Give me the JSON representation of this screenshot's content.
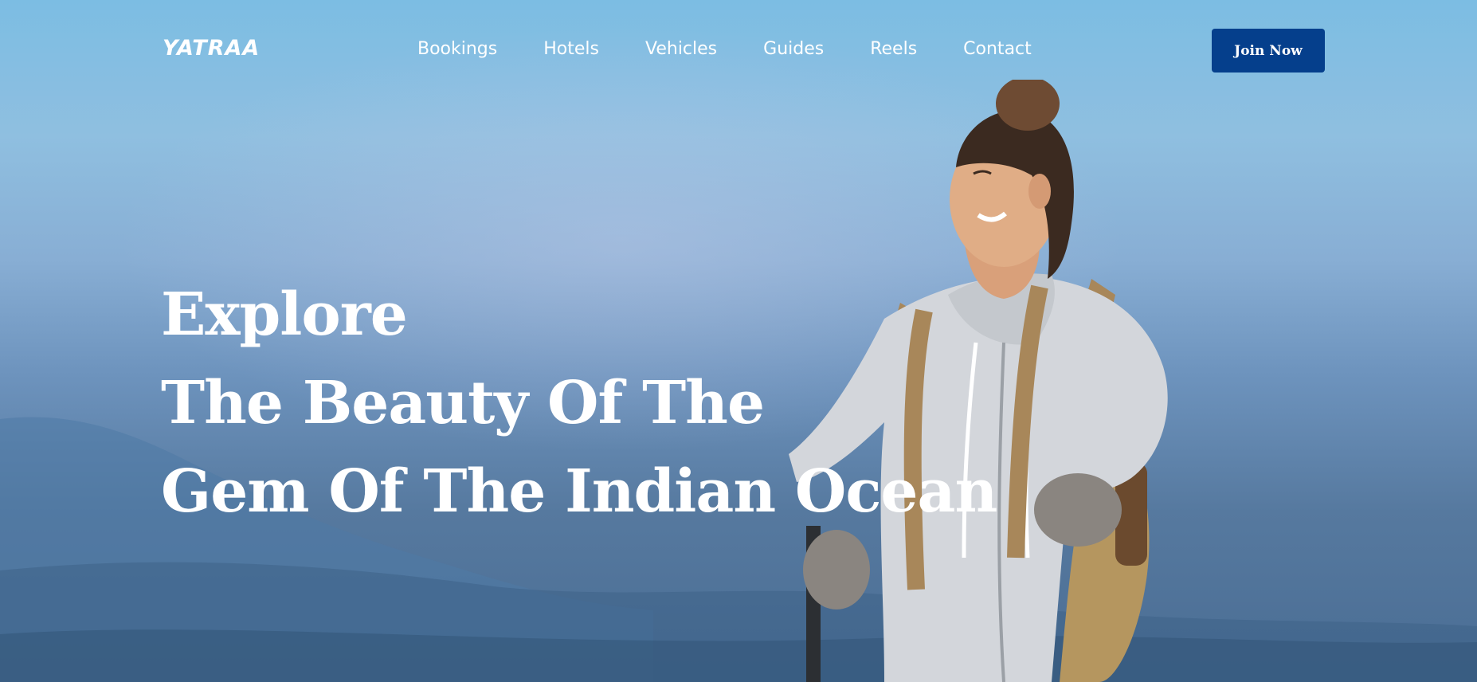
{
  "brand": {
    "logo": "YATRAA"
  },
  "nav": {
    "items": [
      "Bookings",
      "Hotels",
      "Vehicles",
      "Guides",
      "Reels",
      "Contact"
    ],
    "cta_label": "Join Now"
  },
  "hero": {
    "headline_lines": [
      "Explore",
      "The Beauty Of The",
      "Gem Of The Indian Ocean"
    ]
  },
  "colors": {
    "cta_background": "#053f8c",
    "text": "#ffffff",
    "sky_top": "#7cbde3",
    "sky_bottom": "#4a6d94"
  },
  "icons": [
    "hiker-photo"
  ]
}
